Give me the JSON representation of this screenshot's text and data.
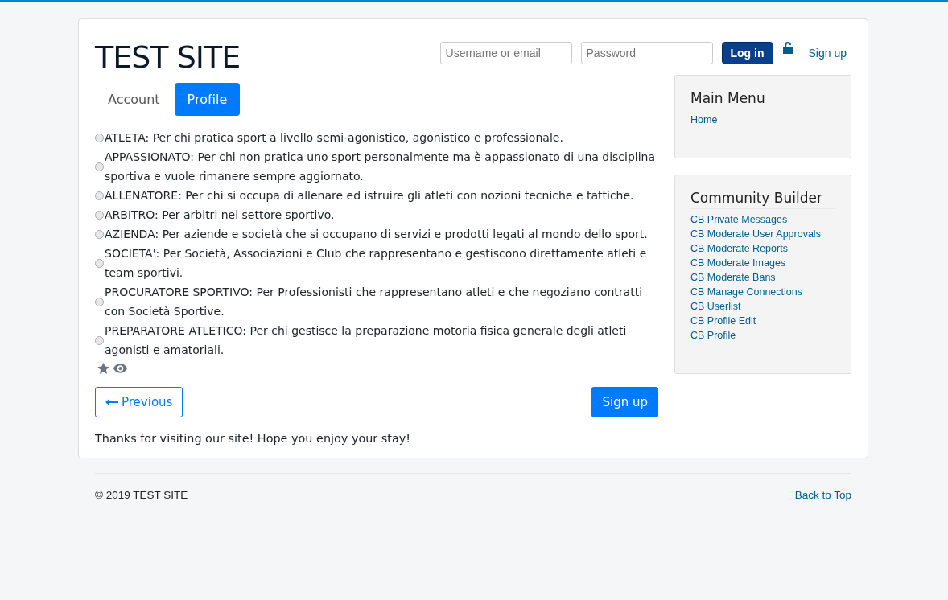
{
  "site_title": "TEST SITE",
  "login": {
    "username_placeholder": "Username or email",
    "password_placeholder": "Password",
    "login_button": "Log in",
    "signup_link": "Sign up"
  },
  "tabs": [
    {
      "label": "Account",
      "selected": false
    },
    {
      "label": "Profile",
      "selected": true
    }
  ],
  "options": [
    {
      "label": "ATLETA: Per chi pratica sport a livello semi-agonistico, agonistico e professionale.",
      "selected": false
    },
    {
      "label": "APPASSIONATO: Per chi non pratica uno sport personalmente ma è appassionato di una disciplina sportiva e vuole rimanere sempre aggiornato.",
      "selected": false
    },
    {
      "label": "ALLENATORE: Per chi si occupa di allenare ed istruire gli atleti con nozioni tecniche e tattiche.",
      "selected": false
    },
    {
      "label": "ARBITRO: Per arbitri nel settore sportivo.",
      "selected": false
    },
    {
      "label": "AZIENDA: Per aziende e società che si occupano di servizi e prodotti legati al mondo dello sport.",
      "selected": false
    },
    {
      "label": "SOCIETA': Per Società, Associazioni e Club che rappresentano e gestiscono direttamente atleti e team sportivi.",
      "selected": false
    },
    {
      "label": "PROCURATORE SPORTIVO: Per Professionisti che rappresentano atleti e che negoziano contratti con Società Sportive.",
      "selected": false
    },
    {
      "label": "PREPARATORE ATLETICO: Per chi gestisce la preparazione motoria fisica generale degli atleti agonisti e amatoriali.",
      "selected": false
    }
  ],
  "previous_button": "Previous",
  "signup_button": "Sign up",
  "thanks": "Thanks for visiting our site! Hope you enjoy your stay!",
  "modules": [
    {
      "title": "Main Menu",
      "links": [
        "Home"
      ]
    },
    {
      "title": "Community Builder",
      "links": [
        "CB Private Messages",
        "CB Moderate User Approvals",
        "CB Moderate Reports",
        "CB Moderate Images",
        "CB Moderate Bans",
        "CB Manage Connections",
        "CB Userlist",
        "CB Profile Edit",
        "CB Profile"
      ]
    }
  ],
  "footer": {
    "copyright": "© 2019 TEST SITE",
    "back_to_top": "Back to Top"
  }
}
